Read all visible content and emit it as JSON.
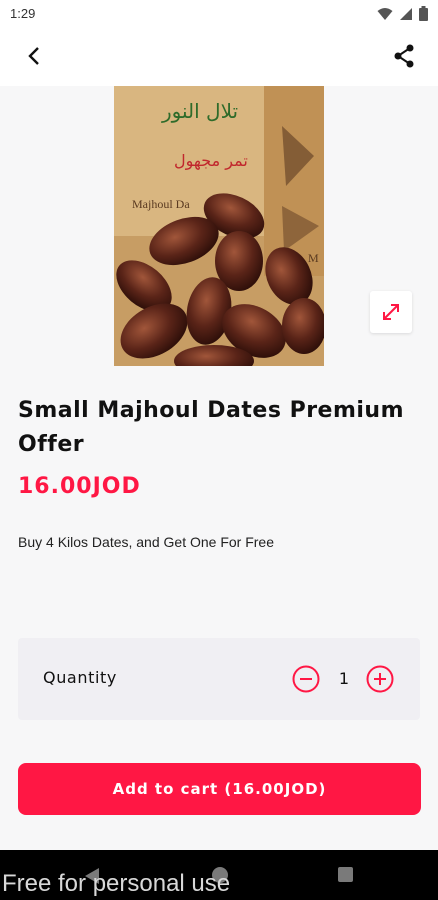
{
  "status_bar": {
    "time": "1:29",
    "icons": [
      "wifi-icon",
      "signal-icon",
      "battery-icon"
    ]
  },
  "app_bar": {
    "back_icon": "chevron-left-icon",
    "share_icon": "share-icon"
  },
  "product": {
    "image_label_arabic_brand": "تلال النور",
    "image_label_arabic_product": "تمر مجهول",
    "image_label_latin": "Majhoul Da",
    "image_label_side": "M",
    "title": "Small Majhoul Dates Premium Offer",
    "price": "16.00JOD",
    "description": "Buy 4 Kilos Dates, and Get One For Free"
  },
  "quantity": {
    "label": "Quantity",
    "value": "1"
  },
  "cart": {
    "button_label": "Add to cart (16.00JOD)"
  },
  "watermark": "Free for personal use",
  "colors": {
    "accent": "#ff1744",
    "background": "#f7f7f8",
    "card": "#f0eff3"
  }
}
